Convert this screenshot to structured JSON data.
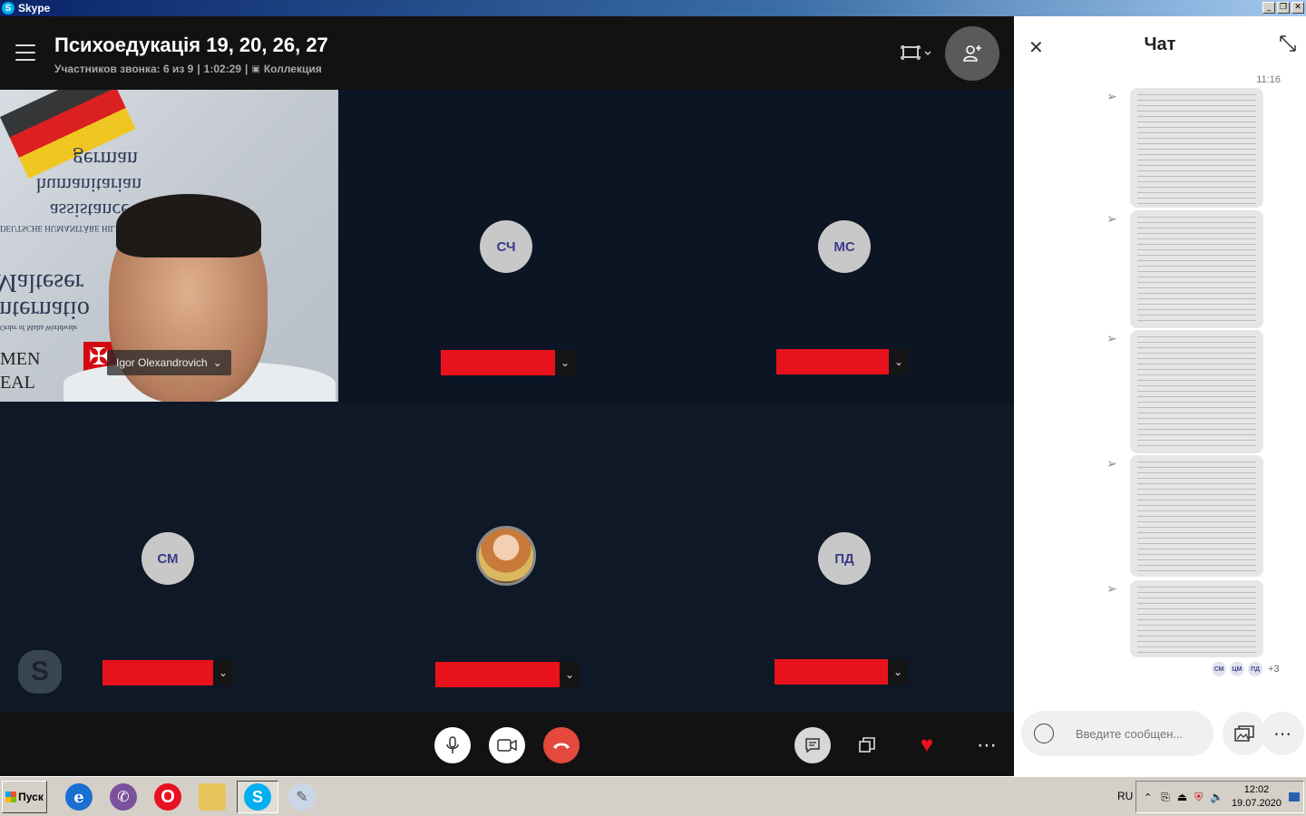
{
  "window": {
    "title": "Skype"
  },
  "call": {
    "title": "Психоедукація 19, 20, 26, 27",
    "participants": "Участников звонка: 6 из 9",
    "duration": "1:02:29",
    "collection": "Коллекция"
  },
  "tiles": [
    {
      "name": "Igor Olexandrovich",
      "type": "video"
    },
    {
      "initials": "СЧ",
      "type": "avatar"
    },
    {
      "initials": "МС",
      "type": "avatar"
    },
    {
      "initials": "СМ",
      "type": "avatar"
    },
    {
      "initials": "",
      "type": "photo"
    },
    {
      "initials": "ПД",
      "type": "avatar"
    }
  ],
  "video_text": {
    "line1": "german",
    "line2": "humanitarian",
    "line3": "assistance",
    "line4": "DEUTSCHE HUMANITÄRE HILFE",
    "line5": "Malteser",
    "line6": "Internatio",
    "line7": "Order of Malta Worldwide",
    "line8": "MEN",
    "line9": "EAL"
  },
  "chat": {
    "title": "Чат",
    "time": "11:16",
    "readers": [
      "СМ",
      "ЦМ",
      "ПД"
    ],
    "more_readers": "+3",
    "composer_placeholder": "Введите сообщен..."
  },
  "taskbar": {
    "start_label": "Пуск",
    "language": "RU",
    "time": "12:02",
    "date": "19.07.2020"
  },
  "colors": {
    "accent": "#00aff0",
    "hangup": "#e5483d",
    "redaction": "#e8121c",
    "heart": "#e8121c"
  }
}
